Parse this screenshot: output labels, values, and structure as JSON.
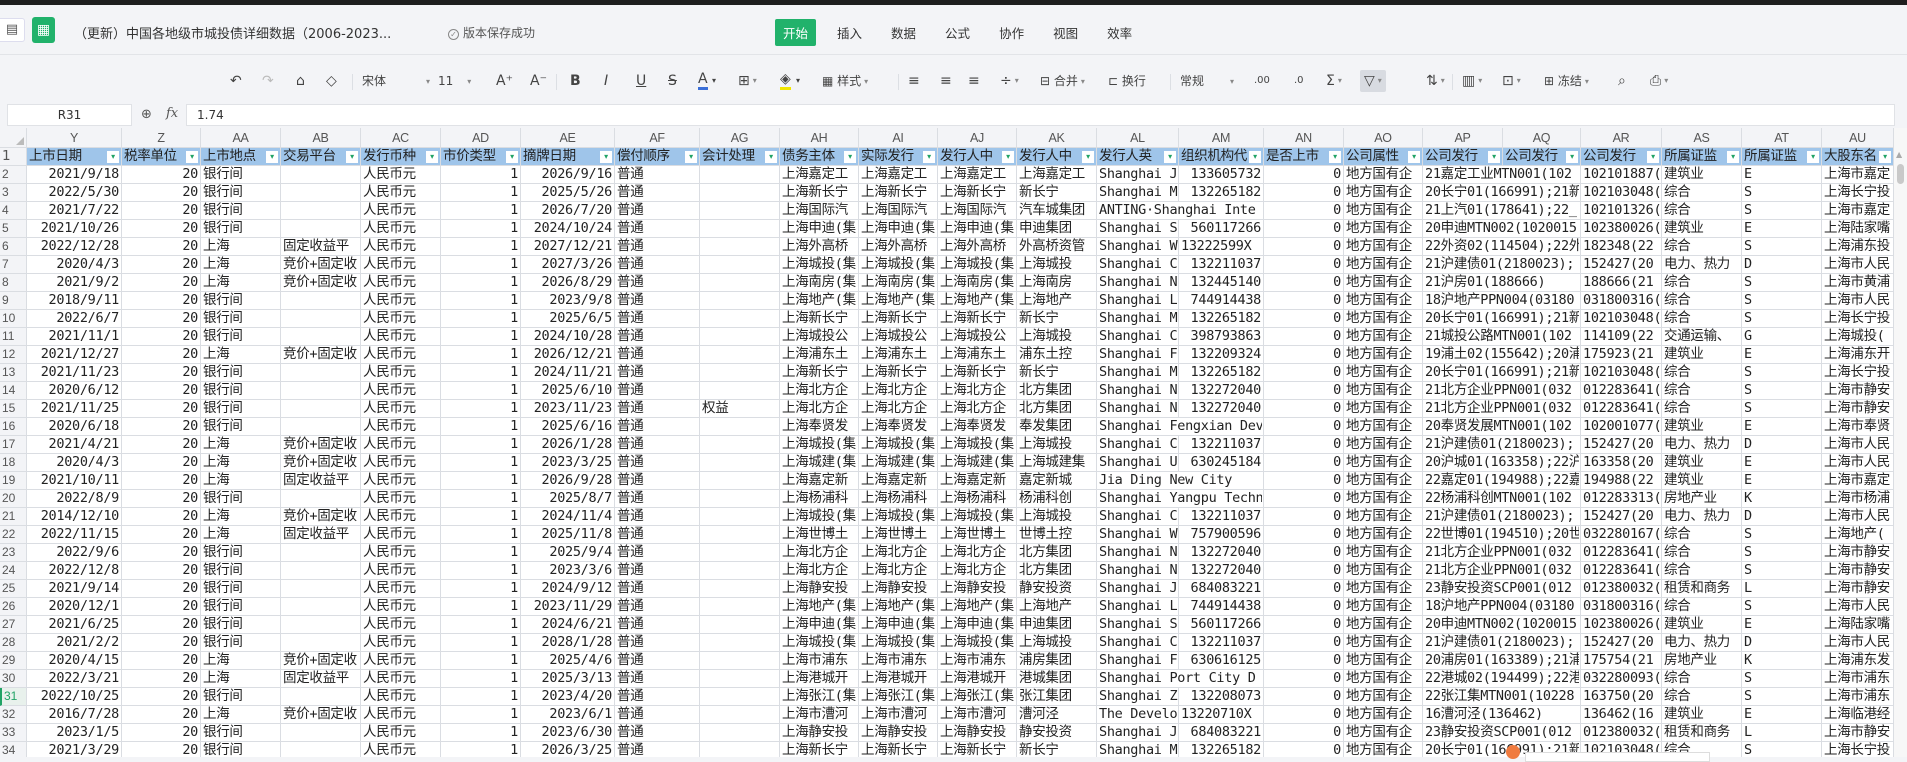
{
  "app": {
    "doc_title": "（更新）中国各地级市城投债详细数据（2006-2023...",
    "save_status": "版本保存成功",
    "menu": [
      "开始",
      "插入",
      "数据",
      "公式",
      "协作",
      "视图",
      "效率"
    ],
    "active_menu": "开始",
    "accent": "#21b26b"
  },
  "toolbar": {
    "font_name": "宋体",
    "font_size": "11",
    "style_label": "样式",
    "merge_label": "合并",
    "wrap_label": "换行",
    "number_format": "常规",
    "freeze_label": "冻结",
    "bold": "B",
    "italic": "I",
    "underline": "U",
    "strike": "S",
    "font_color": "A",
    "grow": "A⁺",
    "shrink": "A⁻",
    "dec_inc": ".00",
    "dec_dec": ".0",
    "sum": "Σ"
  },
  "formula_bar": {
    "cell_ref": "R31",
    "fx": "fx",
    "value": "1.74"
  },
  "grid": {
    "selected_row": 31,
    "columns": [
      "Y",
      "Z",
      "AA",
      "AB",
      "AC",
      "AD",
      "AE",
      "AF",
      "AG",
      "AH",
      "AI",
      "AJ",
      "AK",
      "AL",
      "AM",
      "AN",
      "AO",
      "AP",
      "AQ",
      "AR",
      "AS",
      "AT",
      "AU"
    ],
    "headers": [
      "上市日期",
      "税率单位",
      "上市地点",
      "交易平台",
      "发行币种",
      "市价类型",
      "摘牌日期",
      "偿付顺序",
      "会计处理",
      "债务主体",
      "实际发行",
      "发行人中",
      "发行人中",
      "发行人英",
      "组织机构代",
      "是否上市",
      "公司属性",
      "公司发行",
      "公司发行",
      "公司发行",
      "所属证监",
      "所属证监",
      "大股东名"
    ],
    "rows": [
      [
        "2021/9/18",
        "20",
        "银行间",
        "",
        "人民币元",
        "1",
        "2026/9/16",
        "普通",
        "",
        "上海嘉定工",
        "上海嘉定工",
        "上海嘉定工",
        "上海嘉定工",
        "Shanghai J",
        "133605732",
        "0",
        "地方国有企",
        "21嘉定工业MTN001(102",
        "",
        "102101887(",
        "建筑业",
        "E",
        "上海市嘉定"
      ],
      [
        "2022/5/30",
        "20",
        "银行间",
        "",
        "人民币元",
        "1",
        "2025/5/26",
        "普通",
        "",
        "上海新长宁",
        "上海新长宁",
        "上海新长宁",
        "新长宁",
        "Shanghai M",
        "132265182",
        "0",
        "地方国有企",
        "20长宁01(166991);21新",
        "",
        "102103048(",
        "综合",
        "S",
        "上海长宁投"
      ],
      [
        "2021/7/22",
        "20",
        "银行间",
        "",
        "人民币元",
        "1",
        "2026/7/20",
        "普通",
        "",
        "上海国际汽",
        "上海国际汽",
        "上海国际汽",
        "汽车城集团",
        "ANTING·Shanghai Inte",
        "",
        "0",
        "地方国有企",
        "21上汽01(178641);22_",
        "",
        "102101326(",
        "综合",
        "S",
        "上海市嘉定"
      ],
      [
        "2021/10/26",
        "20",
        "银行间",
        "",
        "人民币元",
        "1",
        "2024/10/24",
        "普通",
        "",
        "上海申迪(集",
        "上海申迪(集",
        "上海申迪(集",
        "申迪集团",
        "Shanghai S",
        "560117266",
        "0",
        "地方国有企",
        "20申迪MTN002(1020015",
        "",
        "102380026(",
        "建筑业",
        "E",
        "上海陆家嘴"
      ],
      [
        "2022/12/28",
        "20",
        "上海",
        "固定收益平",
        "人民币元",
        "1",
        "2027/12/21",
        "普通",
        "",
        "上海外高桥",
        "上海外高桥",
        "上海外高桥",
        "外高桥资管",
        "Shanghai W",
        "13222599X",
        "0",
        "地方国有企",
        "22外资02(114504);22外",
        "",
        "182348(22",
        "综合",
        "S",
        "上海浦东投"
      ],
      [
        "2020/4/3",
        "20",
        "上海",
        "竞价+固定收",
        "人民币元",
        "1",
        "2027/3/26",
        "普通",
        "",
        "上海城投(集",
        "上海城投(集",
        "上海城投(集",
        "上海城投",
        "Shanghai C",
        "132211037",
        "0",
        "地方国有企",
        "21沪建债01(2180023);",
        "",
        "152427(20",
        "电力、热力",
        "D",
        "上海市人民"
      ],
      [
        "2021/9/2",
        "20",
        "上海",
        "竞价+固定收",
        "人民币元",
        "1",
        "2026/8/29",
        "普通",
        "",
        "上海南房(集",
        "上海南房(集",
        "上海南房(集",
        "上海南房",
        "Shanghai N",
        "132445140",
        "0",
        "地方国有企",
        "21沪房01(188666)",
        "",
        "188666(21",
        "综合",
        "S",
        "上海市黄浦"
      ],
      [
        "2018/9/11",
        "20",
        "银行间",
        "",
        "人民币元",
        "1",
        "2023/9/8",
        "普通",
        "",
        "上海地产(集",
        "上海地产(集",
        "上海地产(集",
        "上海地产",
        "Shanghai L",
        "744914438",
        "0",
        "地方国有企",
        "18沪地产PPN004(03180",
        "",
        "031800316(",
        "综合",
        "S",
        "上海市人民"
      ],
      [
        "2022/6/7",
        "20",
        "银行间",
        "",
        "人民币元",
        "1",
        "2025/6/5",
        "普通",
        "",
        "上海新长宁",
        "上海新长宁",
        "上海新长宁",
        "新长宁",
        "Shanghai M",
        "132265182",
        "0",
        "地方国有企",
        "20长宁01(166991);21新",
        "",
        "102103048(",
        "综合",
        "S",
        "上海长宁投"
      ],
      [
        "2021/11/1",
        "20",
        "银行间",
        "",
        "人民币元",
        "1",
        "2024/10/28",
        "普通",
        "",
        "上海城投公",
        "上海城投公",
        "上海城投公",
        "上海城投",
        "Shanghai C",
        "398793863",
        "0",
        "地方国有企",
        "21城投公路MTN001(102",
        "",
        "114109(22",
        "交通运输、",
        "G",
        "上海城投("
      ],
      [
        "2021/12/27",
        "20",
        "上海",
        "竞价+固定收",
        "人民币元",
        "1",
        "2026/12/21",
        "普通",
        "",
        "上海浦东土",
        "上海浦东土",
        "上海浦东土",
        "浦东土控",
        "Shanghai F",
        "132209324",
        "0",
        "地方国有企",
        "19浦土02(155642);20浦",
        "",
        "175923(21",
        "建筑业",
        "E",
        "上海浦东开"
      ],
      [
        "2021/11/23",
        "20",
        "银行间",
        "",
        "人民币元",
        "1",
        "2024/11/21",
        "普通",
        "",
        "上海新长宁",
        "上海新长宁",
        "上海新长宁",
        "新长宁",
        "Shanghai M",
        "132265182",
        "0",
        "地方国有企",
        "20长宁01(166991);21新",
        "",
        "102103048(",
        "综合",
        "S",
        "上海长宁投"
      ],
      [
        "2020/6/12",
        "20",
        "银行间",
        "",
        "人民币元",
        "1",
        "2025/6/10",
        "普通",
        "",
        "上海北方企",
        "上海北方企",
        "上海北方企",
        "北方集团",
        "Shanghai N",
        "132272040",
        "0",
        "地方国有企",
        "21北方企业PPN001(032",
        "",
        "012283641(",
        "综合",
        "S",
        "上海市静安"
      ],
      [
        "2021/11/25",
        "20",
        "银行间",
        "",
        "人民币元",
        "1",
        "2023/11/23",
        "普通",
        "权益",
        "上海北方企",
        "上海北方企",
        "上海北方企",
        "北方集团",
        "Shanghai N",
        "132272040",
        "0",
        "地方国有企",
        "21北方企业PPN001(032",
        "",
        "012283641(",
        "综合",
        "S",
        "上海市静安"
      ],
      [
        "2020/6/18",
        "20",
        "银行间",
        "",
        "人民币元",
        "1",
        "2025/6/16",
        "普通",
        "",
        "上海奉贤发",
        "上海奉贤发",
        "上海奉贤发",
        "奉发集团",
        "Shanghai Fengxian Dev",
        "",
        "0",
        "地方国有企",
        "20奉贤发展MTN001(102",
        "",
        "102001077(",
        "建筑业",
        "E",
        "上海市奉贤"
      ],
      [
        "2021/4/21",
        "20",
        "上海",
        "竞价+固定收",
        "人民币元",
        "1",
        "2026/1/28",
        "普通",
        "",
        "上海城投(集",
        "上海城投(集",
        "上海城投(集",
        "上海城投",
        "Shanghai C",
        "132211037",
        "0",
        "地方国有企",
        "21沪建债01(2180023);",
        "",
        "152427(20",
        "电力、热力",
        "D",
        "上海市人民"
      ],
      [
        "2020/4/3",
        "20",
        "上海",
        "竞价+固定收",
        "人民币元",
        "1",
        "2023/3/25",
        "普通",
        "",
        "上海城建(集",
        "上海城建(集",
        "上海城建(集",
        "上海城建集",
        "Shanghai U",
        "630245184",
        "0",
        "地方国有企",
        "20沪城01(163358);22沪",
        "",
        "163358(20",
        "建筑业",
        "E",
        "上海市人民"
      ],
      [
        "2021/10/11",
        "20",
        "上海",
        "固定收益平",
        "人民币元",
        "1",
        "2026/9/28",
        "普通",
        "",
        "上海嘉定新",
        "上海嘉定新",
        "上海嘉定新",
        "嘉定新城",
        "Jia Ding New City",
        "",
        "0",
        "地方国有企",
        "22嘉定01(194988);22嘉",
        "",
        "194988(22",
        "建筑业",
        "E",
        "上海市嘉定"
      ],
      [
        "2022/8/9",
        "20",
        "银行间",
        "",
        "人民币元",
        "1",
        "2025/8/7",
        "普通",
        "",
        "上海杨浦科",
        "上海杨浦科",
        "上海杨浦科",
        "杨浦科创",
        "Shanghai Yangpu Techn",
        "",
        "0",
        "地方国有企",
        "22杨浦科创MTN001(102",
        "",
        "012283313(",
        "房地产业",
        "K",
        "上海市杨浦"
      ],
      [
        "2014/12/10",
        "20",
        "上海",
        "竞价+固定收",
        "人民币元",
        "1",
        "2024/11/4",
        "普通",
        "",
        "上海城投(集",
        "上海城投(集",
        "上海城投(集",
        "上海城投",
        "Shanghai C",
        "132211037",
        "0",
        "地方国有企",
        "21沪建债01(2180023);",
        "",
        "152427(20",
        "电力、热力",
        "D",
        "上海市人民"
      ],
      [
        "2022/11/15",
        "20",
        "上海",
        "固定收益平",
        "人民币元",
        "1",
        "2025/11/8",
        "普通",
        "",
        "上海世博土",
        "上海世博土",
        "上海世博土",
        "世博土控",
        "Shanghai W",
        "757900596",
        "0",
        "地方国有企",
        "22世博01(194510);20世",
        "",
        "032280167(",
        "综合",
        "S",
        "上海地产("
      ],
      [
        "2022/9/6",
        "20",
        "银行间",
        "",
        "人民币元",
        "1",
        "2025/9/4",
        "普通",
        "",
        "上海北方企",
        "上海北方企",
        "上海北方企",
        "北方集团",
        "Shanghai N",
        "132272040",
        "0",
        "地方国有企",
        "21北方企业PPN001(032",
        "",
        "012283641(",
        "综合",
        "S",
        "上海市静安"
      ],
      [
        "2022/12/8",
        "20",
        "银行间",
        "",
        "人民币元",
        "1",
        "2023/3/6",
        "普通",
        "",
        "上海北方企",
        "上海北方企",
        "上海北方企",
        "北方集团",
        "Shanghai N",
        "132272040",
        "0",
        "地方国有企",
        "21北方企业PPN001(032",
        "",
        "012283641(",
        "综合",
        "S",
        "上海市静安"
      ],
      [
        "2021/9/14",
        "20",
        "银行间",
        "",
        "人民币元",
        "1",
        "2024/9/12",
        "普通",
        "",
        "上海静安投",
        "上海静安投",
        "上海静安投",
        "静安投资",
        "Shanghai J",
        "684083221",
        "0",
        "地方国有企",
        "23静安投资SCP001(012",
        "",
        "012380032(",
        "租赁和商务",
        "L",
        "上海市静安"
      ],
      [
        "2020/12/1",
        "20",
        "银行间",
        "",
        "人民币元",
        "1",
        "2023/11/29",
        "普通",
        "",
        "上海地产(集",
        "上海地产(集",
        "上海地产(集",
        "上海地产",
        "Shanghai L",
        "744914438",
        "0",
        "地方国有企",
        "18沪地产PPN004(03180",
        "",
        "031800316(",
        "综合",
        "S",
        "上海市人民"
      ],
      [
        "2021/6/25",
        "20",
        "银行间",
        "",
        "人民币元",
        "1",
        "2024/6/21",
        "普通",
        "",
        "上海申迪(集",
        "上海申迪(集",
        "上海申迪(集",
        "申迪集团",
        "Shanghai S",
        "560117266",
        "0",
        "地方国有企",
        "20申迪MTN002(1020015",
        "",
        "102380026(",
        "建筑业",
        "E",
        "上海陆家嘴"
      ],
      [
        "2021/2/2",
        "20",
        "银行间",
        "",
        "人民币元",
        "1",
        "2028/1/28",
        "普通",
        "",
        "上海城投(集",
        "上海城投(集",
        "上海城投(集",
        "上海城投",
        "Shanghai C",
        "132211037",
        "0",
        "地方国有企",
        "21沪建债01(2180023);",
        "",
        "152427(20",
        "电力、热力",
        "D",
        "上海市人民"
      ],
      [
        "2020/4/15",
        "20",
        "上海",
        "竞价+固定收",
        "人民币元",
        "1",
        "2025/4/6",
        "普通",
        "",
        "上海市浦东",
        "上海市浦东",
        "上海市浦东",
        "浦房集团",
        "Shanghai F",
        "630616125",
        "0",
        "地方国有企",
        "20浦房01(163389);21浦",
        "",
        "175754(21",
        "房地产业",
        "K",
        "上海浦东发"
      ],
      [
        "2022/3/21",
        "20",
        "上海",
        "固定收益平",
        "人民币元",
        "1",
        "2025/3/13",
        "普通",
        "",
        "上海港城开",
        "上海港城开",
        "上海港城开",
        "港城集团",
        "Shanghai Port City D",
        "",
        "0",
        "地方国有企",
        "22港城02(194499);22港",
        "",
        "032280093(",
        "综合",
        "S",
        "上海市浦东"
      ],
      [
        "2022/10/25",
        "20",
        "银行间",
        "",
        "人民币元",
        "1",
        "2023/4/20",
        "普通",
        "",
        "上海张江(集",
        "上海张江(集",
        "上海张江(集",
        "张江集团",
        "Shanghai Z",
        "132208073",
        "0",
        "地方国有企",
        "22张江集MTN001(10228",
        "",
        "163750(20",
        "综合",
        "S",
        "上海市浦东"
      ],
      [
        "2016/7/28",
        "20",
        "上海",
        "竞价+固定收",
        "人民币元",
        "1",
        "2023/6/1",
        "普通",
        "",
        "上海市漕河",
        "上海市漕河",
        "上海市漕河",
        "漕河泾",
        "The Develo",
        "13220710X",
        "0",
        "地方国有企",
        "16漕河泾(136462)",
        "",
        "136462(16",
        "建筑业",
        "E",
        "上海临港经"
      ],
      [
        "2023/1/5",
        "20",
        "银行间",
        "",
        "人民币元",
        "1",
        "2023/6/30",
        "普通",
        "",
        "上海静安投",
        "上海静安投",
        "上海静安投",
        "静安投资",
        "Shanghai J",
        "684083221",
        "0",
        "地方国有企",
        "23静安投资SCP001(012",
        "",
        "012380032(",
        "租赁和商务",
        "L",
        "上海市静安"
      ],
      [
        "2021/3/29",
        "20",
        "银行间",
        "",
        "人民币元",
        "1",
        "2026/3/25",
        "普通",
        "",
        "上海新长宁",
        "上海新长宁",
        "上海新长宁",
        "新长宁",
        "Shanghai M",
        "132265182",
        "0",
        "地方国有企",
        "20长宁01(166991);21新",
        "",
        "102103048(",
        "综合",
        "S",
        "上海长宁投"
      ]
    ]
  }
}
